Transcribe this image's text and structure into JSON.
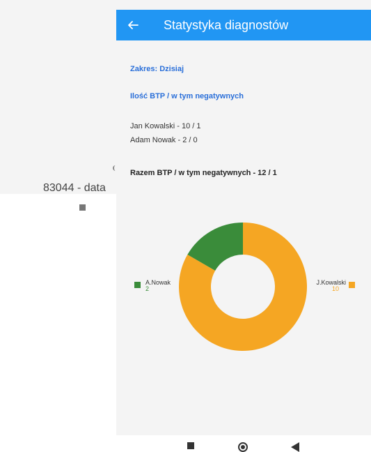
{
  "background": {
    "footer_text": "83044 - data"
  },
  "appbar": {
    "title": "Statystyka diagnostów",
    "back_icon": "arrow-left-icon"
  },
  "stats": {
    "zakres": "Zakres: Dzisiaj",
    "ilosc_heading": "Ilość BTP / w tym negatywnych",
    "rows": [
      "Jan Kowalski - 10 / 1",
      "Adam Nowak - 2 / 0"
    ],
    "razem": "Razem BTP / w tym negatywnych - 12 / 1"
  },
  "chart_data": {
    "type": "pie",
    "variant": "donut",
    "slices": [
      {
        "label": "J.Kowalski",
        "value": 10,
        "color": "#f5a623"
      },
      {
        "label": "A.Nowak",
        "value": 2,
        "color": "#3a8c3a"
      }
    ],
    "title": "",
    "legend": "sides"
  },
  "colors": {
    "accent": "#2196f3",
    "heading_blue": "#2a6fd9"
  },
  "system_nav": {
    "items": [
      "recent-apps-icon",
      "home-icon",
      "back-icon"
    ]
  }
}
